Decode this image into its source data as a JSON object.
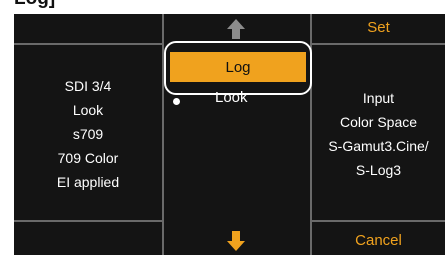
{
  "page_title": "Log]",
  "left_panel": [
    "SDI 3/4",
    "Look",
    "s709",
    "709 Color",
    "EI applied"
  ],
  "center": {
    "selected": "Log",
    "next_item": "Look"
  },
  "right_panel": [
    "Input",
    "Color Space",
    "S-Gamut3.Cine/",
    "S-Log3"
  ],
  "buttons": {
    "set": "Set",
    "cancel": "Cancel"
  },
  "colors": {
    "accent": "#f0a21e",
    "background": "#141414",
    "divider": "#6a6a6a",
    "up_arrow": "#8c8c8c"
  },
  "icons": {
    "up": "arrow-up-icon",
    "down": "arrow-down-icon"
  }
}
